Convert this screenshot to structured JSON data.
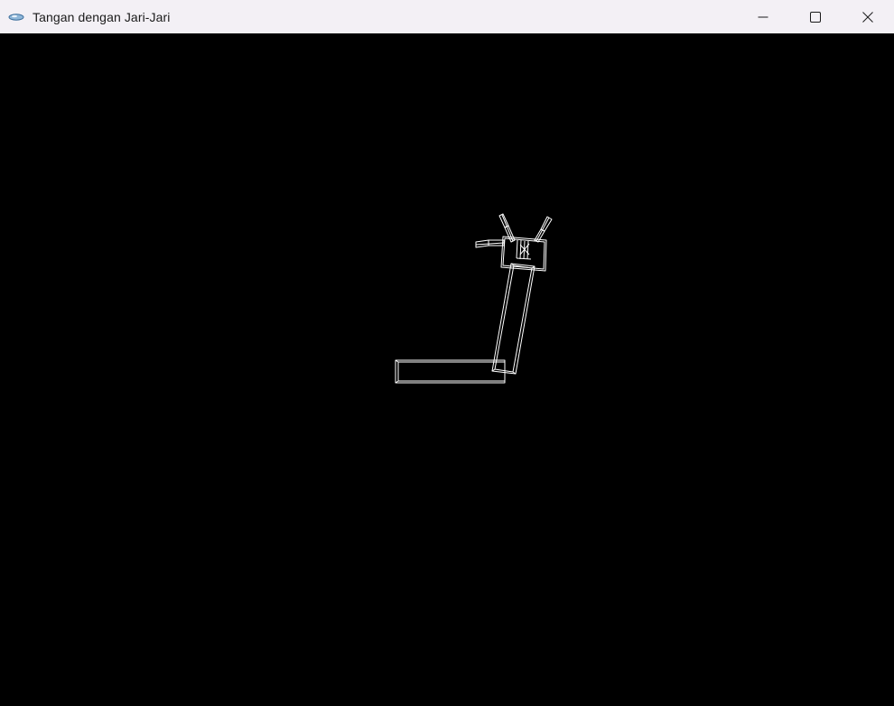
{
  "window": {
    "title": "Tangan dengan Jari-Jari",
    "icon": "opengl-app-icon",
    "controls": {
      "minimize": "minimize-icon",
      "maximize": "maximize-icon",
      "close": "close-icon"
    }
  },
  "scene": {
    "background": "#000000",
    "stroke": "#ffffff",
    "render_mode": "wireframe"
  }
}
